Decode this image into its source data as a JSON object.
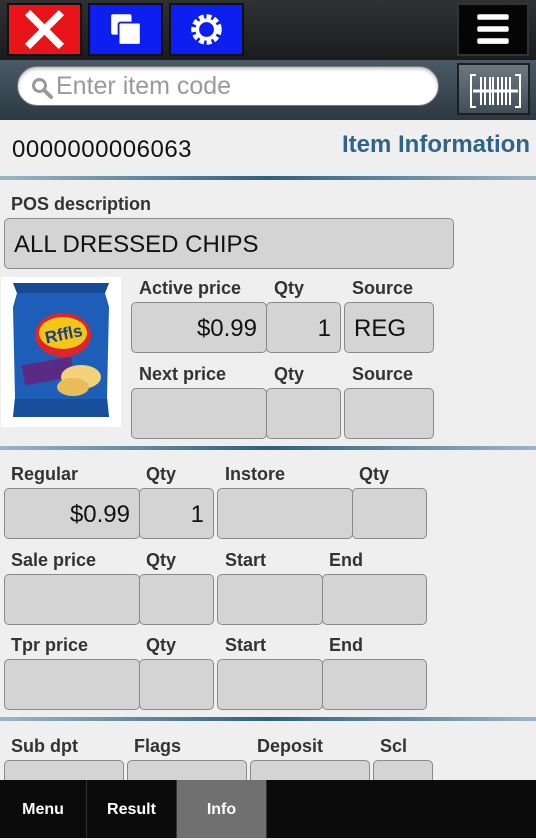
{
  "toolbar": {
    "close_icon": "close-x-icon",
    "windows_icon": "windows-stack-icon",
    "settings_icon": "gear-icon",
    "menu_icon": "hamburger-menu-icon",
    "colors": {
      "close": "#e8141a",
      "blue": "#0c1ff0",
      "bar": "#222426"
    }
  },
  "search": {
    "placeholder": "Enter item code",
    "value": "",
    "scan_icon": "barcode-scan-icon"
  },
  "item": {
    "code": "0000000006063",
    "section_title": "Item Information",
    "pos_description_label": "POS description",
    "pos_description": "ALL DRESSED CHIPS",
    "image_alt": "Ruffles All Dressed chips bag"
  },
  "active": {
    "price_label": "Active price",
    "qty_label": "Qty",
    "source_label": "Source",
    "price": "$0.99",
    "qty": "1",
    "source": "REG"
  },
  "next": {
    "price_label": "Next price",
    "qty_label": "Qty",
    "source_label": "Source",
    "price": "",
    "qty": "",
    "source": ""
  },
  "regular": {
    "label": "Regular",
    "qty_label": "Qty",
    "instore_label": "Instore",
    "instore_qty_label": "Qty",
    "price": "$0.99",
    "qty": "1",
    "instore": "",
    "instore_qty": ""
  },
  "sale": {
    "label": "Sale price",
    "qty_label": "Qty",
    "start_label": "Start",
    "end_label": "End",
    "price": "",
    "qty": "",
    "start": "",
    "end": ""
  },
  "tpr": {
    "label": "Tpr price",
    "qty_label": "Qty",
    "start_label": "Start",
    "end_label": "End",
    "price": "",
    "qty": "",
    "start": "",
    "end": ""
  },
  "misc": {
    "sub_dpt_label": "Sub dpt",
    "flags_label": "Flags",
    "deposit_label": "Deposit",
    "scl_label": "Scl"
  },
  "nav": {
    "tabs": [
      "Menu",
      "Result",
      "Info"
    ],
    "active": "Info"
  }
}
